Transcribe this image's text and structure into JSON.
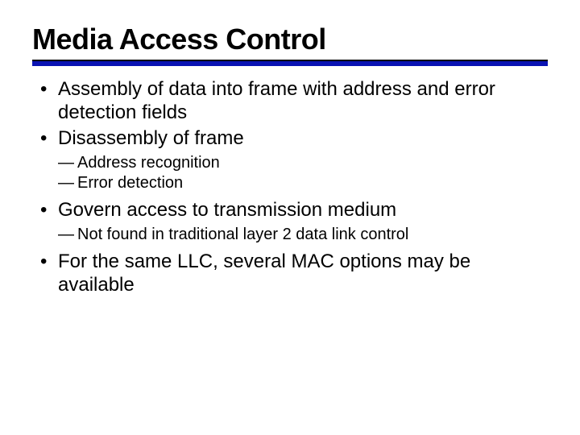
{
  "title": "Media Access Control",
  "bullets": [
    {
      "text": "Assembly of data into frame with address and error detection fields",
      "sub": []
    },
    {
      "text": "Disassembly of frame",
      "sub": [
        "Address recognition",
        "Error detection"
      ]
    },
    {
      "text": "Govern access to transmission medium",
      "sub": [
        "Not found in traditional layer 2 data link control"
      ]
    },
    {
      "text": "For the same LLC, several MAC options may be available",
      "sub": []
    }
  ]
}
